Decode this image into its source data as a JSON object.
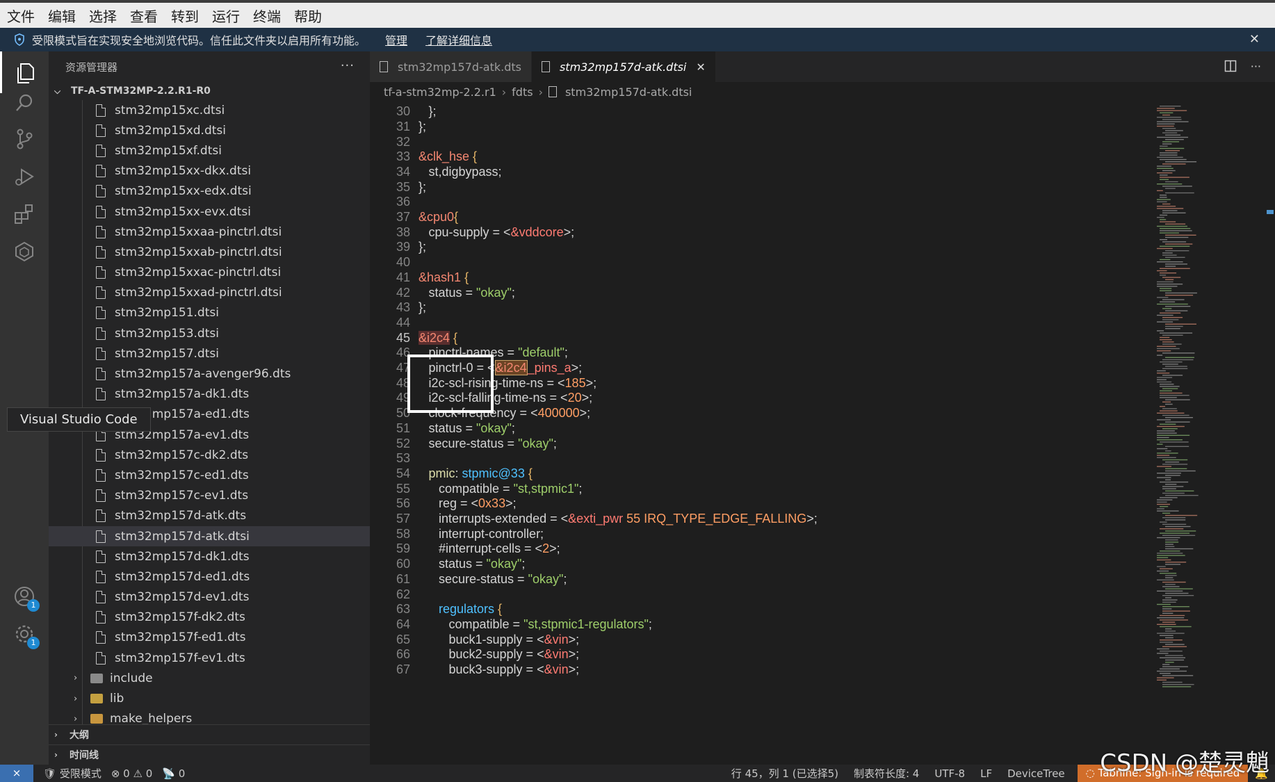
{
  "menu": [
    "文件",
    "编辑",
    "选择",
    "查看",
    "转到",
    "运行",
    "终端",
    "帮助"
  ],
  "banner": {
    "message": "受限模式旨在实现安全地浏览代码。信任此文件夹以启用所有功能。",
    "manage": "管理",
    "learn_more": "了解详细信息"
  },
  "sidebar": {
    "title": "资源管理器",
    "folder": "TF-A-STM32MP-2.2.R1-R0",
    "files": [
      "stm32mp15xc.dtsi",
      "stm32mp15xd.dtsi",
      "stm32mp15xf.dtsi",
      "stm32mp15xx-dkx.dtsi",
      "stm32mp15xx-edx.dtsi",
      "stm32mp15xx-evx.dtsi",
      "stm32mp15xxaa-pinctrl.dtsi",
      "stm32mp15xxab-pinctrl.dtsi",
      "stm32mp15xxac-pinctrl.dtsi",
      "stm32mp15xxad-pinctrl.dtsi",
      "stm32mp151.dtsi",
      "stm32mp153.dtsi",
      "stm32mp157.dtsi",
      "stm32mp157a-avenger96.dts",
      "stm32mp157a-dk1.dts",
      "stm32mp157a-ed1.dts",
      "stm32mp157a-ev1.dts",
      "stm32mp157c-dk2.dts",
      "stm32mp157c-ed1.dts",
      "stm32mp157c-ev1.dts",
      "stm32mp157d-atk.dts",
      "stm32mp157d-atk.dtsi",
      "stm32mp157d-dk1.dts",
      "stm32mp157d-ed1.dts",
      "stm32mp157d-ev1.dts",
      "stm32mp157f-dk2.dts",
      "stm32mp157f-ed1.dts",
      "stm32mp157f-ev1.dts"
    ],
    "selected_index": 21,
    "folders": [
      "include",
      "lib",
      "make_helpers"
    ],
    "tooltip": "Visual Studio Code",
    "outline": "大纲",
    "timeline": "时间线"
  },
  "activity": {
    "icons": [
      "explorer-icon",
      "search-icon",
      "source-control-icon",
      "run-debug-icon",
      "extensions-icon",
      "remote-explorer-icon"
    ],
    "account_badge": "1",
    "settings_badge": "1"
  },
  "tabs": [
    {
      "label": "stm32mp157d-atk.dts",
      "active": false
    },
    {
      "label": "stm32mp157d-atk.dtsi",
      "active": true
    }
  ],
  "breadcrumb": [
    "tf-a-stm32mp-2.2.r1",
    "fdts",
    "stm32mp157d-atk.dtsi"
  ],
  "code": {
    "current_line": 45,
    "lines": [
      {
        "n": 30,
        "i": 1,
        "t": [
          [
            "pl",
            "};"
          ]
        ]
      },
      {
        "n": 31,
        "i": 0,
        "t": [
          [
            "pl",
            "};"
          ]
        ]
      },
      {
        "n": 32,
        "i": 0,
        "t": []
      },
      {
        "n": 33,
        "i": 0,
        "t": [
          [
            "k",
            "&clk_hse"
          ],
          [
            "br",
            " {"
          ]
        ]
      },
      {
        "n": 34,
        "i": 1,
        "t": [
          [
            "pl",
            "st,digbypass;"
          ]
        ]
      },
      {
        "n": 35,
        "i": 0,
        "t": [
          [
            "pl",
            "};"
          ]
        ]
      },
      {
        "n": 36,
        "i": 0,
        "t": []
      },
      {
        "n": 37,
        "i": 0,
        "t": [
          [
            "k",
            "&cpu0"
          ],
          [
            "br",
            "{"
          ]
        ]
      },
      {
        "n": 38,
        "i": 1,
        "t": [
          [
            "pl",
            "cpu-supply = <"
          ],
          [
            "ref",
            "&vddcore"
          ],
          [
            "pl",
            ">;"
          ]
        ]
      },
      {
        "n": 39,
        "i": 0,
        "t": [
          [
            "pl",
            "};"
          ]
        ]
      },
      {
        "n": 40,
        "i": 0,
        "t": []
      },
      {
        "n": 41,
        "i": 0,
        "t": [
          [
            "k",
            "&hash1"
          ],
          [
            "br",
            " {"
          ]
        ]
      },
      {
        "n": 42,
        "i": 1,
        "t": [
          [
            "pl",
            "status = "
          ],
          [
            "s",
            "\"okay\""
          ],
          [
            "pl",
            ";"
          ]
        ]
      },
      {
        "n": 43,
        "i": 0,
        "t": [
          [
            "pl",
            "};"
          ]
        ]
      },
      {
        "n": 44,
        "i": 0,
        "t": []
      },
      {
        "n": 45,
        "i": 0,
        "t": [
          [
            "sel",
            "&i2c4"
          ],
          [
            "br",
            " {"
          ]
        ]
      },
      {
        "n": 46,
        "i": 1,
        "t": [
          [
            "pl",
            "pinctrl-names = "
          ],
          [
            "s",
            "\"default\""
          ],
          [
            "pl",
            ";"
          ]
        ]
      },
      {
        "n": 47,
        "i": 1,
        "t": [
          [
            "pl",
            "pinctrl-0 = <"
          ],
          [
            "hl",
            "&i2c4"
          ],
          [
            "ref",
            "_pins_a"
          ],
          [
            "pl",
            ">;"
          ]
        ]
      },
      {
        "n": 48,
        "i": 1,
        "t": [
          [
            "pl",
            "i2c-scl-rising-time-ns = <"
          ],
          [
            "pn",
            "185"
          ],
          [
            "pl",
            ">;"
          ]
        ]
      },
      {
        "n": 49,
        "i": 1,
        "t": [
          [
            "pl",
            "i2c-scl-falling-time-ns = <"
          ],
          [
            "pn",
            "20"
          ],
          [
            "pl",
            ">;"
          ]
        ]
      },
      {
        "n": 50,
        "i": 1,
        "t": [
          [
            "pl",
            "clock-frequency = <"
          ],
          [
            "pn",
            "400000"
          ],
          [
            "pl",
            ">;"
          ]
        ]
      },
      {
        "n": 51,
        "i": 1,
        "t": [
          [
            "pl",
            "status = "
          ],
          [
            "s",
            "\"okay\""
          ],
          [
            "pl",
            ";"
          ]
        ]
      },
      {
        "n": 52,
        "i": 1,
        "t": [
          [
            "pl",
            "secure-status = "
          ],
          [
            "s",
            "\"okay\""
          ],
          [
            "pl",
            ";"
          ]
        ]
      },
      {
        "n": 53,
        "i": 0,
        "t": []
      },
      {
        "n": 54,
        "i": 1,
        "t": [
          [
            "lbl",
            "pmic"
          ],
          [
            "pl",
            ": "
          ],
          [
            "nd",
            "stpmic@33"
          ],
          [
            "br",
            " {"
          ]
        ]
      },
      {
        "n": 55,
        "i": 2,
        "t": [
          [
            "pl",
            "compatible = "
          ],
          [
            "s",
            "\"st,stpmic1\""
          ],
          [
            "pl",
            ";"
          ]
        ]
      },
      {
        "n": 56,
        "i": 2,
        "t": [
          [
            "pl",
            "reg = <"
          ],
          [
            "pn",
            "0x33"
          ],
          [
            "pl",
            ">;"
          ]
        ]
      },
      {
        "n": 57,
        "i": 2,
        "t": [
          [
            "pl",
            "interrupts-extended = <"
          ],
          [
            "ref",
            "&exti_pwr"
          ],
          [
            "pn",
            " 55 IRQ_TYPE_EDGE_FALLING"
          ],
          [
            "pl",
            ">;"
          ]
        ]
      },
      {
        "n": 58,
        "i": 2,
        "t": [
          [
            "pl",
            "interrupt-controller;"
          ]
        ]
      },
      {
        "n": 59,
        "i": 2,
        "t": [
          [
            "pl",
            "#interrupt-cells = <"
          ],
          [
            "pn",
            "2"
          ],
          [
            "pl",
            ">;"
          ]
        ]
      },
      {
        "n": 60,
        "i": 2,
        "t": [
          [
            "pl",
            "status = "
          ],
          [
            "s",
            "\"okay\""
          ],
          [
            "pl",
            ";"
          ]
        ]
      },
      {
        "n": 61,
        "i": 2,
        "t": [
          [
            "pl",
            "secure-status = "
          ],
          [
            "s",
            "\"okay\""
          ],
          [
            "pl",
            ";"
          ]
        ]
      },
      {
        "n": 62,
        "i": 0,
        "t": []
      },
      {
        "n": 63,
        "i": 2,
        "t": [
          [
            "nd",
            "regulators"
          ],
          [
            "br",
            " {"
          ]
        ]
      },
      {
        "n": 64,
        "i": 3,
        "t": [
          [
            "pl",
            "compatible = "
          ],
          [
            "s",
            "\"st,stpmic1-regulators\""
          ],
          [
            "pl",
            ";"
          ]
        ]
      },
      {
        "n": 65,
        "i": 3,
        "t": [
          [
            "pl",
            "buck1-supply = <"
          ],
          [
            "ref",
            "&vin"
          ],
          [
            "pl",
            ">;"
          ]
        ]
      },
      {
        "n": 66,
        "i": 3,
        "t": [
          [
            "pl",
            "buck2-supply = <"
          ],
          [
            "ref",
            "&vin"
          ],
          [
            "pl",
            ">;"
          ]
        ]
      },
      {
        "n": 67,
        "i": 3,
        "t": [
          [
            "pl",
            "buck3-supply = <"
          ],
          [
            "ref",
            "&vin"
          ],
          [
            "pl",
            ">;"
          ]
        ]
      }
    ]
  },
  "status": {
    "restricted": "受限模式",
    "errors": "0",
    "warnings": "0",
    "ports": "0",
    "position": "行 45，列 1 (已选择5)",
    "tab_size": "制表符长度: 4",
    "encoding": "UTF-8",
    "eol": "LF",
    "language": "DeviceTree",
    "tabnine": "Tabnine: Sign-in is required"
  },
  "watermark": "CSDN @楚灵魈"
}
